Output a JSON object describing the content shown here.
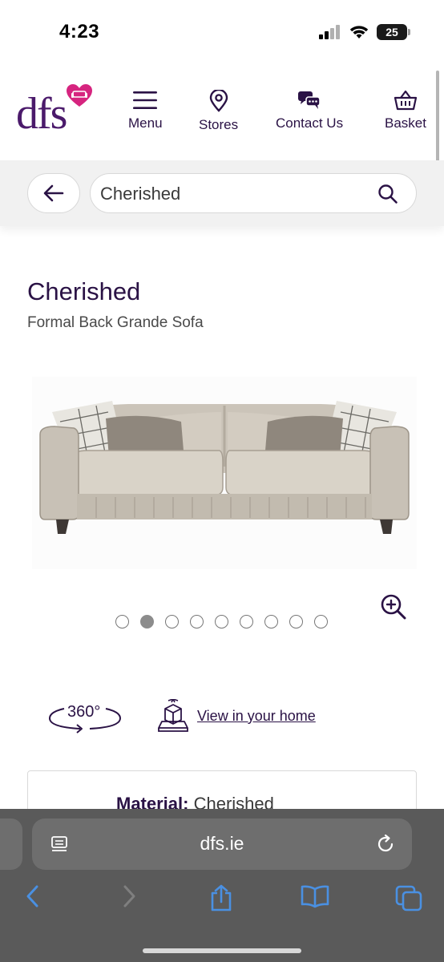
{
  "status_bar": {
    "time": "4:23",
    "battery_level": "25"
  },
  "header": {
    "logo_text": "dfs",
    "nav": [
      {
        "label": "Menu",
        "icon": "hamburger-icon"
      },
      {
        "label": "Stores",
        "icon": "map-pin-icon"
      },
      {
        "label": "Contact Us",
        "icon": "chat-bubbles-icon"
      },
      {
        "label": "Basket",
        "icon": "basket-icon"
      }
    ]
  },
  "search": {
    "value": "Cherished"
  },
  "product": {
    "title": "Cherished",
    "subtitle": "Formal Back Grande Sofa",
    "image_count": 9,
    "active_image": 2,
    "view_360_label": "360°",
    "view_in_home_label": "View in your home",
    "material_label": "Material:",
    "material_value": "Cherished"
  },
  "browser": {
    "url": "dfs.ie"
  },
  "colors": {
    "brand_purple": "#2a1245",
    "logo_purple": "#4b1a6b",
    "logo_heart": "#d6247f",
    "search_band": "#f1f1f1",
    "toolbar": "#5a5a5a",
    "ios_blue": "#4a90e2"
  }
}
